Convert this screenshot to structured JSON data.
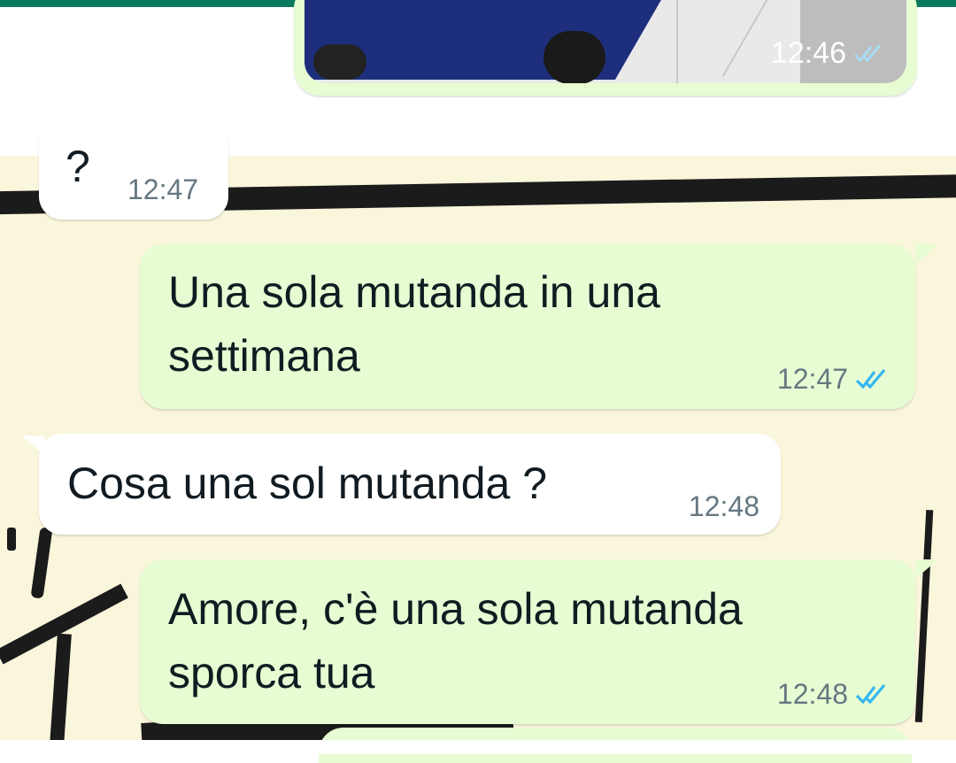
{
  "colors": {
    "outgoing_bubble": "#e7fcd3",
    "incoming_bubble": "#ffffff",
    "read_tick": "#34b7f1",
    "header_accent": "#0b7a5c",
    "wallpaper": "#faf6dc"
  },
  "messages": [
    {
      "id": "m0",
      "direction": "outgoing",
      "type": "image",
      "time": "12:46",
      "status": "read",
      "status_icon": "double-check-icon"
    },
    {
      "id": "m1",
      "direction": "incoming",
      "text": "?",
      "time": "12:47"
    },
    {
      "id": "m2",
      "direction": "outgoing",
      "lines": [
        "Una sola mutanda in una",
        "settimana"
      ],
      "time": "12:47",
      "status": "read",
      "status_icon": "double-check-icon"
    },
    {
      "id": "m3",
      "direction": "incoming",
      "text": "Cosa una sol mutanda ?",
      "time": "12:48"
    },
    {
      "id": "m4",
      "direction": "outgoing",
      "lines": [
        "Amore, c'è una sola mutanda",
        "sporca tua"
      ],
      "time": "12:48",
      "status": "read",
      "status_icon": "double-check-icon"
    }
  ]
}
